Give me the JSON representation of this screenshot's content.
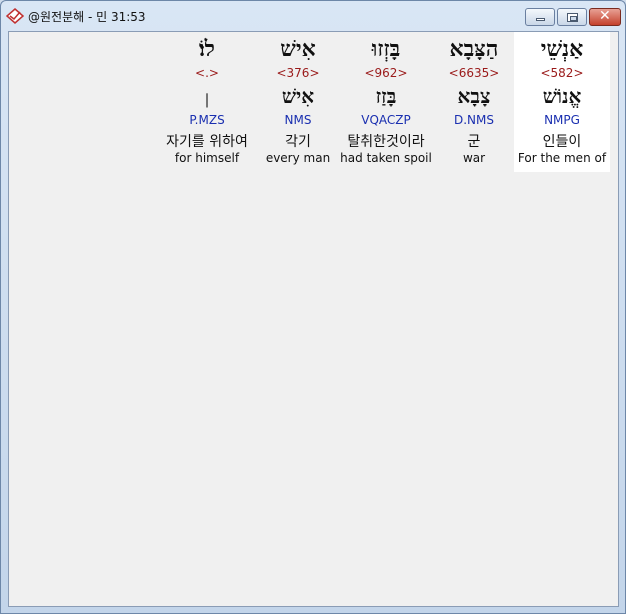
{
  "window": {
    "title": "@원전분해 - 민 31:53",
    "close_glyph": "✕"
  },
  "words": [
    {
      "hebrew": "אַנְשֵׁי",
      "strong": "<582>",
      "lemma": "אֱנוֹשׁ",
      "morph": "NMPG",
      "korean": "인들이",
      "english": "For the men of",
      "highlight": true
    },
    {
      "hebrew": "הַצָּבָא",
      "strong": "<6635>",
      "lemma": "צָבָא",
      "morph": "D.NMS",
      "korean": "군",
      "english": "war",
      "highlight": false
    },
    {
      "hebrew": "בָּזְזוּ",
      "strong": "<962>",
      "lemma": "בָּזַז",
      "morph": "VQACZP",
      "korean": "탈취한것이라",
      "english": "had taken spoil",
      "highlight": false
    },
    {
      "hebrew": "אִישׁ",
      "strong": "<376>",
      "lemma": "אִישׁ",
      "morph": "NMS",
      "korean": "각기",
      "english": "every man",
      "highlight": false
    },
    {
      "hebrew": "לוֹ׃",
      "strong": "<.>",
      "lemma": "׀",
      "morph": "P.MZS",
      "korean": "자기를 위하여",
      "english": "for himself",
      "highlight": false
    }
  ],
  "colors": {
    "strong": "#9a1a1a",
    "morph": "#1a2fb0",
    "highlight": "#ffffff"
  },
  "icons": {
    "app": "app-logo-icon",
    "minimize": "minimize-icon",
    "maximize": "maximize-icon",
    "close": "close-icon"
  }
}
